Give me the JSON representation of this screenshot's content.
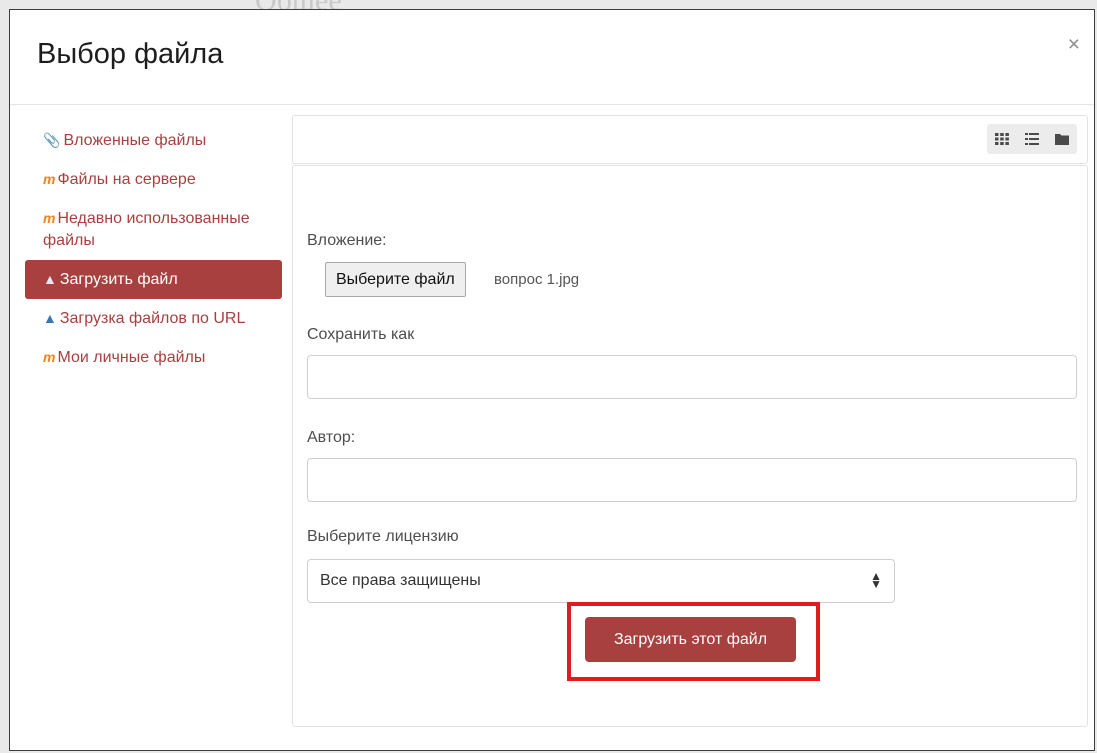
{
  "background_text": "Общее",
  "dialog": {
    "title": "Выбор файла",
    "close_symbol": "×"
  },
  "sidebar": {
    "items": [
      {
        "label": "Вложенные файлы",
        "icon": "attachment-icon",
        "active": false
      },
      {
        "label": "Файлы на сервере",
        "icon": "moodle-icon",
        "active": false
      },
      {
        "label": "Недавно использованные файлы",
        "icon": "moodle-icon",
        "active": false
      },
      {
        "label": "Загрузить файл",
        "icon": "upload-icon",
        "active": true
      },
      {
        "label": "Загрузка файлов по URL",
        "icon": "upload-icon",
        "active": false
      },
      {
        "label": "Мои личные файлы",
        "icon": "moodle-icon",
        "active": false
      }
    ]
  },
  "toolbar": {
    "view_icons": [
      "grid-view-icon",
      "list-view-icon",
      "folder-view-icon"
    ]
  },
  "form": {
    "attachment_label": "Вложение:",
    "choose_file_button": "Выберите файл",
    "chosen_file_name": "вопрос 1.jpg",
    "save_as_label": "Сохранить как",
    "save_as_value": "",
    "author_label": "Автор:",
    "author_value": "",
    "license_label": "Выберите лицензию",
    "license_value": "Все права защищены",
    "upload_button": "Загрузить этот файл"
  },
  "colors": {
    "accent": "#a8403f",
    "highlight": "#e11b22"
  }
}
